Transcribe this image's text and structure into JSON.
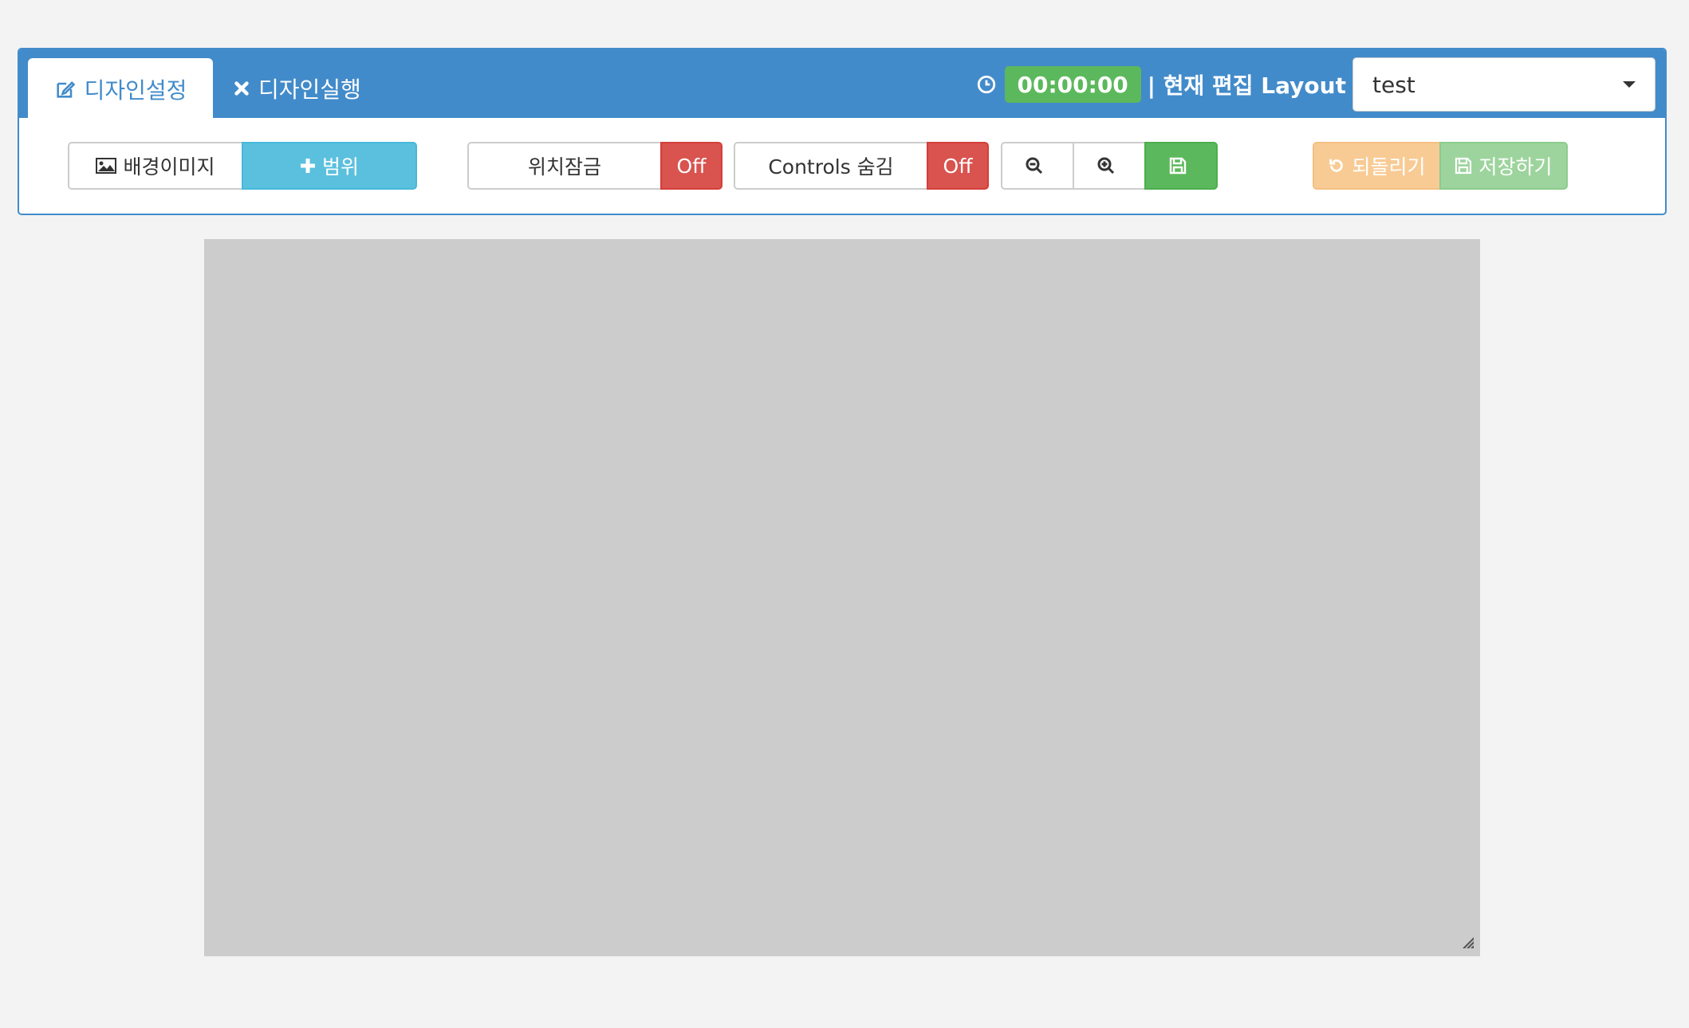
{
  "tabs": {
    "design_settings": "디자인설정",
    "design_run": "디자인실행"
  },
  "header": {
    "timer": "00:00:00",
    "layout_label": "| 현재 편집 Layout",
    "layout_select_value": "test"
  },
  "toolbar": {
    "background_image": "배경이미지",
    "range": "범위",
    "position_lock": "위치잠금",
    "position_lock_state": "Off",
    "controls_hide": "Controls 숨김",
    "controls_hide_state": "Off",
    "revert": "되돌리기",
    "save": "저장하기"
  },
  "colors": {
    "primary": "#428bca",
    "info": "#5bc0de",
    "danger": "#d9534f",
    "success": "#5cb85c",
    "warning_light": "#f8cb95",
    "success_light": "#9dd49d",
    "canvas": "#cccccc"
  },
  "icons": {
    "tab_design_settings": "edit-icon",
    "tab_design_run": "close-icon",
    "header_clock": "clock-icon",
    "background_image": "image-icon",
    "range": "plus-icon",
    "zoom_out": "zoom-out-icon",
    "zoom_in": "zoom-in-icon",
    "save_floppy": "floppy-disk-icon",
    "revert": "undo-icon",
    "save": "floppy-disk-icon",
    "canvas_resize": "resize-handle-icon"
  }
}
